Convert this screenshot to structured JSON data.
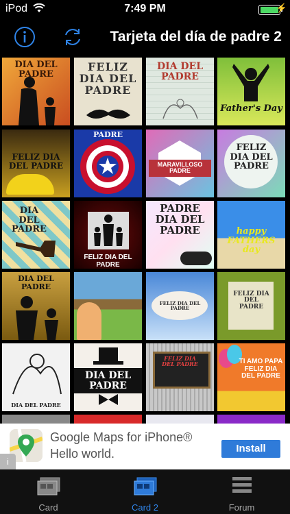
{
  "status_bar": {
    "carrier": "iPod",
    "time": "7:49 PM"
  },
  "nav": {
    "title": "Tarjeta del día de padre 2"
  },
  "cards": [
    {
      "text": "DIA DEL PADRE"
    },
    {
      "text": "FELIZ DIA DEL PADRE"
    },
    {
      "text": "DIA DEL PADRE"
    },
    {
      "text": "Father's Day"
    },
    {
      "text": "FELIZ DIA DEL PADRE"
    },
    {
      "text": "PADRE"
    },
    {
      "text": "MARAVILLOSO PADRE"
    },
    {
      "text": "FELIZ DIA DEL PADRE"
    },
    {
      "text": "DIA DEL PADRE"
    },
    {
      "text": "FELIZ DIA DEL PADRE"
    },
    {
      "text": "PADRE DIA DEL PADRE"
    },
    {
      "text": "happy FATHERS day"
    },
    {
      "text": "DIA DEL PADRE"
    },
    {
      "text": ""
    },
    {
      "text": "FELIZ DIA DEL PADRE"
    },
    {
      "text": "FELIZ DIA DEL PADRE"
    },
    {
      "text": "DIA DEL PADRE"
    },
    {
      "text": "DIA DEL PADRE"
    },
    {
      "text": "FELIZ DIA DEL PADRE"
    },
    {
      "text": "TI AMO PAPA FELIZ DIA DEL PADRE"
    }
  ],
  "ad": {
    "headline": "Google Maps for iPhone®",
    "subline": "Hello world.",
    "install_label": "Install",
    "info_label": "i"
  },
  "tabs": [
    {
      "label": "Card",
      "icon": "card-stack-icon",
      "active": false
    },
    {
      "label": "Card 2",
      "icon": "card-stack-icon",
      "active": true
    },
    {
      "label": "Forum",
      "icon": "list-lines-icon",
      "active": false
    }
  ],
  "colors": {
    "accent": "#2f84e8",
    "install_button": "#2f7bd9",
    "battery": "#4cd964"
  }
}
